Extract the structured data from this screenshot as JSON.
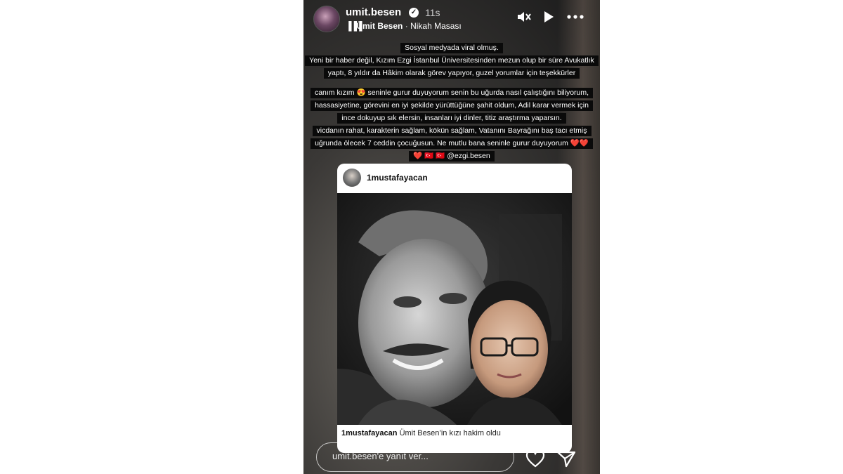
{
  "header": {
    "username": "umit.besen",
    "verified_icon": "verified-badge-icon",
    "time": "11s",
    "music_artist": "Ümit Besen",
    "music_separator": "·",
    "music_track": "Nikah Masası",
    "icons": [
      "mute-icon",
      "play-icon",
      "more-icon"
    ]
  },
  "caption": {
    "lines": [
      "Sosyal medyada viral olmuş.",
      "Yeni bir haber değil, Kızım Ezgi İstanbul Üniversitesinden mezun olup bir süre Avukatlık",
      "yaptı, 8 yıldır da Hâkim olarak görev yapıyor, guzel yorumlar için teşekkürler",
      "canım kızım 😍 seninle gurur duyuyorum senin bu uğurda nasıl çalıştığını biliyorum,",
      "hassasiyetine, görevini en iyi şekilde yürüttüğüne şahit oldum, Adil karar vermek için",
      "ince dokuyup sık elersin, insanları iyi dinler, titiz araştırma yaparsın.",
      "vicdanın rahat, karakterin sağlam, kökün sağlam, Vatanını Bayrağını baş tacı etmiş",
      "uğrunda ölecek 7 ceddin çocuğusun. Ne mutlu bana seninle gurur duyuyorum ❤️❤️",
      "❤️ 🇹🇷 🇹🇷 @ezgi.besen"
    ]
  },
  "post": {
    "username": "1mustafayacan",
    "caption_user": "1mustafayacan",
    "caption_text": "Ümit Besen’in kızı hakim oldu"
  },
  "footer": {
    "reply_placeholder": "umit.besen'e yanıt ver...",
    "icons": [
      "heart-icon",
      "send-icon"
    ]
  }
}
